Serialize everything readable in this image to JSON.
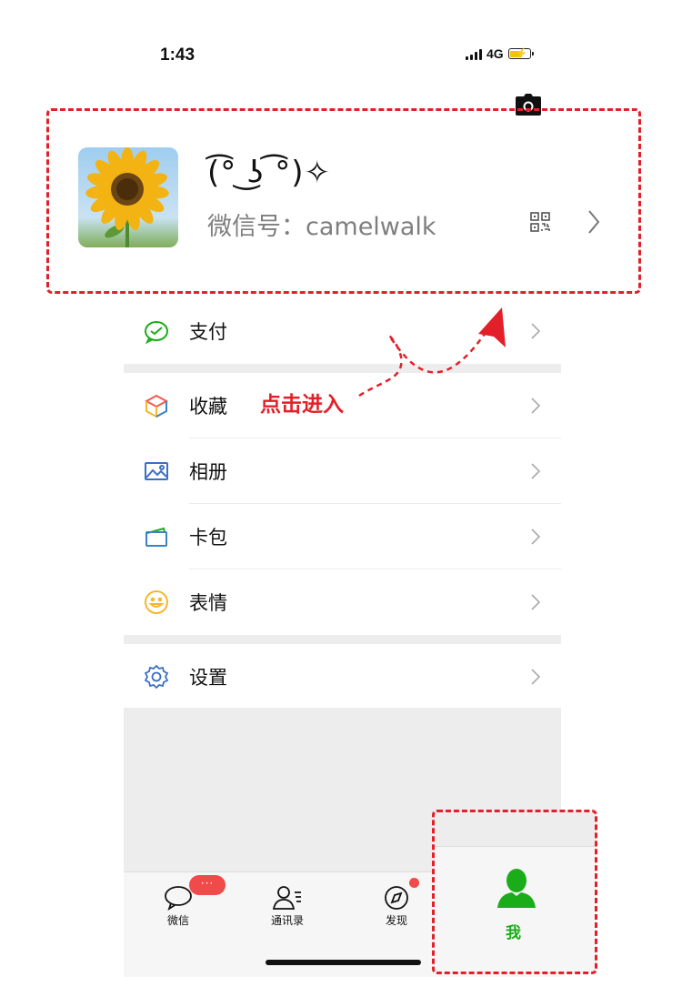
{
  "status_bar": {
    "time": "1:43",
    "network": "4G"
  },
  "profile": {
    "nickname": "(͡° ͜ʖ ͡°)✧",
    "wechat_id_label": "微信号：",
    "wechat_id": "camelwalk"
  },
  "menu": {
    "pay": "支付",
    "favorites": "收藏",
    "album": "相册",
    "cards": "卡包",
    "stickers": "表情",
    "settings": "设置"
  },
  "tabs": {
    "chats": "微信",
    "contacts": "通讯录",
    "discover": "发现",
    "me": "我",
    "chats_badge": "···"
  },
  "annotation": {
    "text": "点击进入",
    "color": "#e3202a"
  },
  "colors": {
    "accent_green": "#1aad19",
    "badge_red": "#f04a4a",
    "annotation_red": "#e3202a"
  },
  "icons": [
    "camera-icon",
    "qr-code-icon",
    "chevron-right-icon",
    "pay-icon",
    "favorites-icon",
    "album-icon",
    "cards-icon",
    "stickers-icon",
    "settings-icon",
    "chat-bubble-icon",
    "contacts-icon",
    "compass-icon",
    "person-icon"
  ]
}
